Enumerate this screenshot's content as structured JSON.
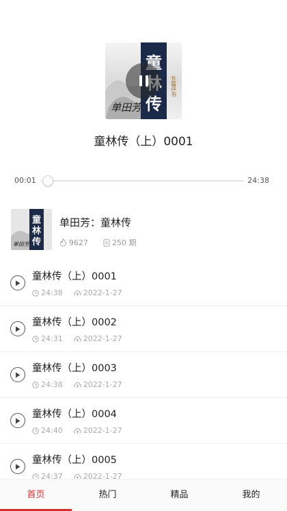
{
  "player": {
    "title": "童林传（上）0001",
    "current_time": "00:01",
    "total_time": "24:38",
    "progress": 0.001
  },
  "album": {
    "name": "单田芳：童林传",
    "plays": "9627",
    "episodes_count": "250 期"
  },
  "cover": {
    "big_text": "童林传",
    "small_text": "长篇评书",
    "signature": "单田芳"
  },
  "episodes": [
    {
      "title": "童林传（上）0001",
      "duration": "24:38",
      "date": "2022-1-27"
    },
    {
      "title": "童林传（上）0002",
      "duration": "24:31",
      "date": "2022-1-27"
    },
    {
      "title": "童林传（上）0003",
      "duration": "24:38",
      "date": "2022-1-27"
    },
    {
      "title": "童林传（上）0004",
      "duration": "24:40",
      "date": "2022-1-27"
    },
    {
      "title": "童林传（上）0005",
      "duration": "24:37",
      "date": "2022-1-27"
    }
  ],
  "tabs": [
    "首页",
    "热门",
    "精品",
    "我的"
  ],
  "colors": {
    "accent": "#d32f2f",
    "cover_navy": "#1c2a4a"
  }
}
